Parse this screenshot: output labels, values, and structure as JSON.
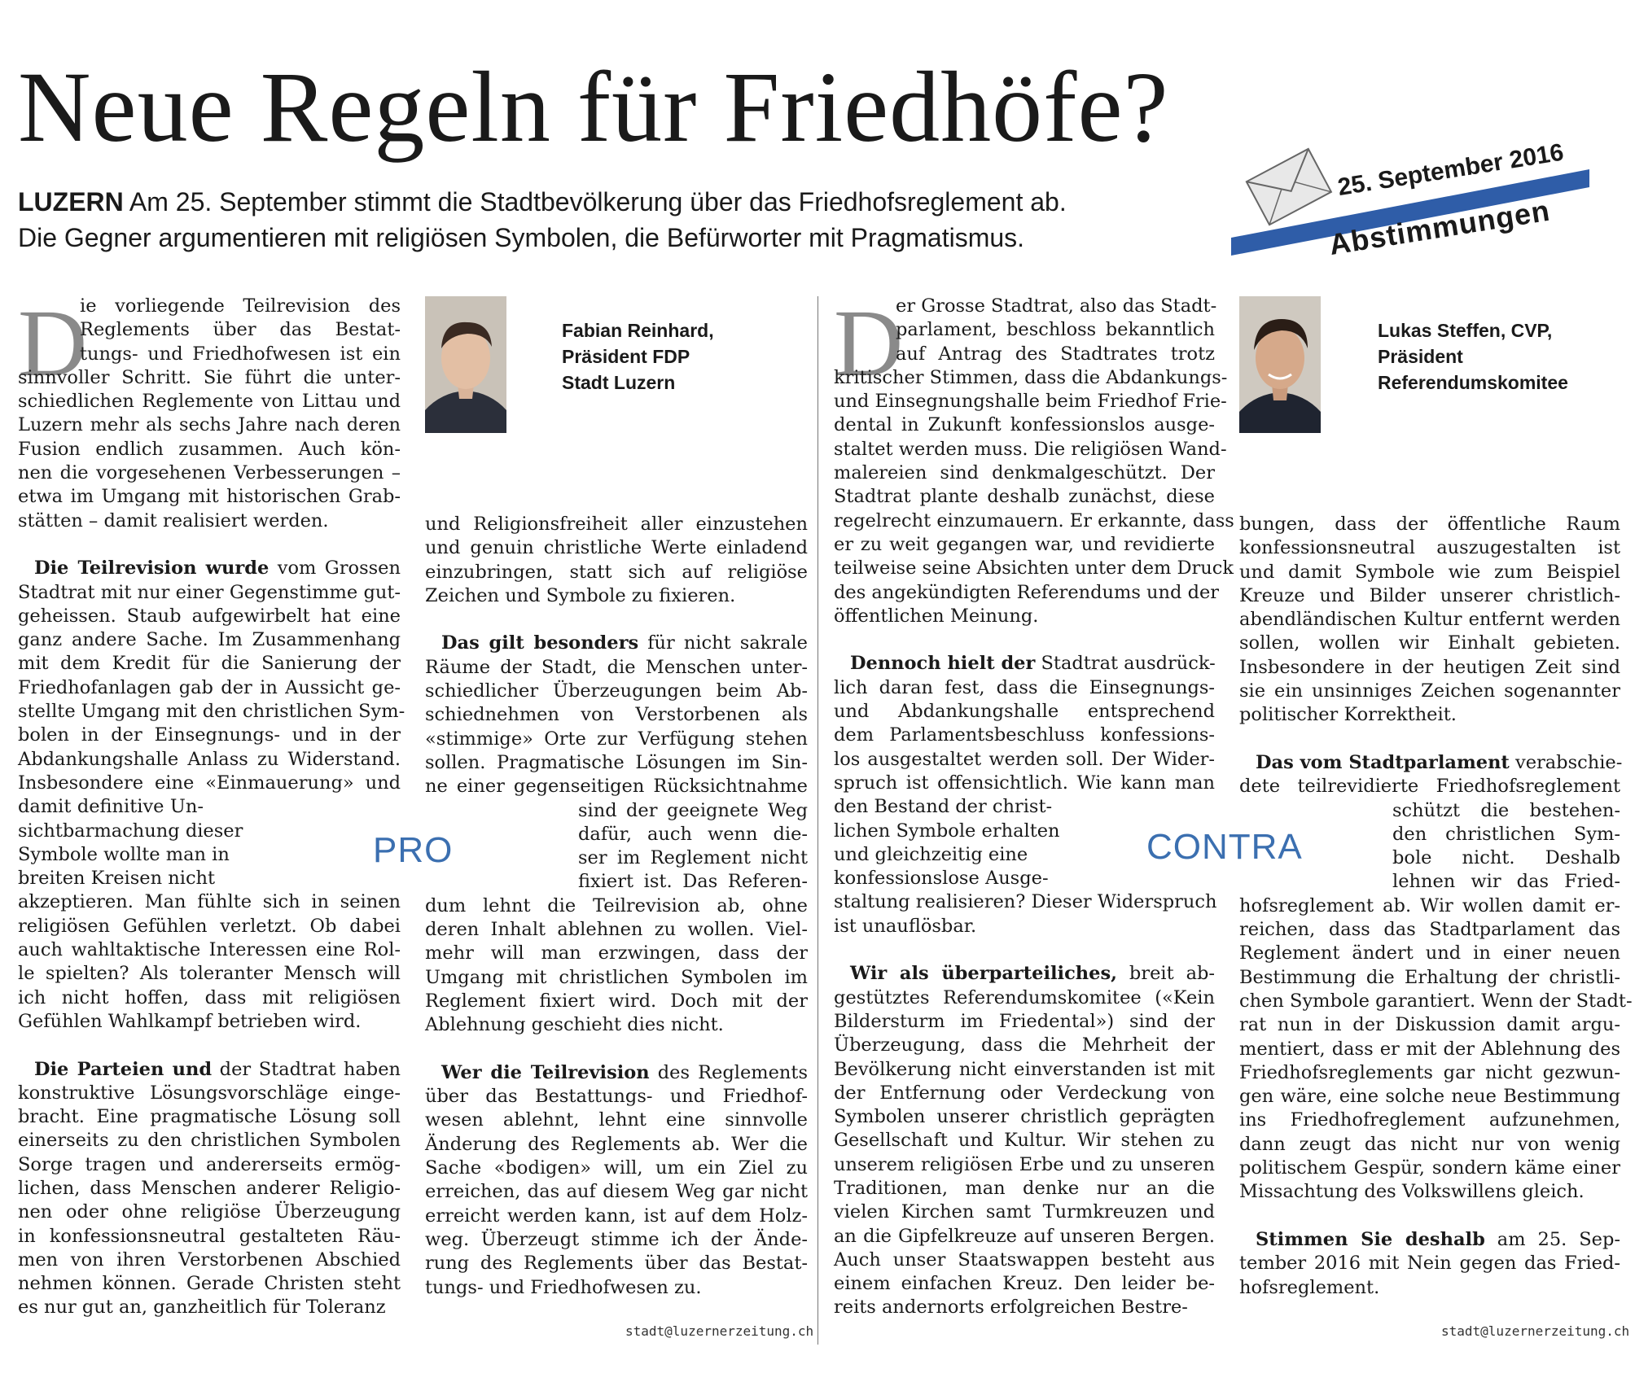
{
  "header": {
    "title": "Neue Regeln für Friedhöfe?",
    "dateline": "LUZERN",
    "lead_line1": "Am 25. September stimmt die Stadtbevölkerung über das Friedhofsreglement ab.",
    "lead_line2": "Die Gegner argumentieren mit religiösen Symbolen, die Befürworter mit Pragmatismus."
  },
  "badge": {
    "date": "25. September 2016",
    "label": "Abstimmungen",
    "accent_color": "#2f5da8",
    "icon": "envelope-icon"
  },
  "pro": {
    "side_label": "PRO",
    "author_name": "Fabian Reinhard,",
    "author_role1": "Präsident FDP",
    "author_role2": "Stadt Luzern",
    "photo_icon": "portrait-photo",
    "email": "stadt@luzernerzeitung.ch",
    "dropcap": "D",
    "col1": [
      "ie vorliegende Teilrevision des",
      "Reglements über das Bestat-",
      "tungs- und Friedhofwesen ist ein",
      "sinnvoller Schritt. Sie führt die unter-",
      "schiedlichen Reglemente von Littau und",
      "Luzern mehr als sechs Jahre nach deren",
      "Fusion endlich zusammen. Auch kön-",
      "nen die vorgesehenen Verbesserungen –",
      "etwa im Umgang mit historischen Grab-",
      "stätten – damit realisiert werden.",
      "Die Teilrevision wurde|vom Grossen",
      "Stadtrat mit nur einer Gegenstimme gut-",
      "geheissen. Staub aufgewirbelt hat eine",
      "ganz andere Sache. Im Zusammenhang",
      "mit dem Kredit für die Sanierung der",
      "Friedhofanlagen gab der in Aussicht ge-",
      "stellte Umgang mit den christlichen Sym-",
      "bolen in der Einsegnungs- und in der",
      "Abdankungshalle Anlass zu Widerstand.",
      "Insbesondere eine «Einmauerung» und",
      "damit definitive Un-",
      "sichtbarmachung dieser",
      "Symbole wollte man in",
      "breiten Kreisen nicht",
      "akzeptieren. Man fühlte sich in seinen",
      "religiösen Gefühlen verletzt. Ob dabei",
      "auch wahltaktische Interessen eine Rol-",
      "le spielten? Als toleranter Mensch will",
      "ich nicht hoffen, dass mit religiösen",
      "Gefühlen Wahlkampf betrieben wird.",
      "Die Parteien und|der Stadtrat haben",
      "konstruktive Lösungsvorschläge einge-",
      "bracht. Eine pragmatische Lösung soll",
      "einerseits zu den christlichen Symbolen",
      "Sorge tragen und andererseits ermög-",
      "lichen, dass Menschen anderer Religio-",
      "nen oder ohne religiöse Überzeugung",
      "in konfessionsneutral gestalteten Räu-",
      "men von ihren Verstorbenen Abschied",
      "nehmen können. Gerade Christen steht",
      "es nur gut an, ganzheitlich für Toleranz"
    ],
    "col2": [
      "und Religionsfreiheit aller einzustehen",
      "und genuin christliche Werte einladend",
      "einzubringen, statt sich auf religiöse",
      "Zeichen und Symbole zu fixieren.",
      "Das gilt besonders|für nicht sakrale",
      "Räume der Stadt, die Menschen unter-",
      "schiedlicher Überzeugungen beim Ab-",
      "schiednehmen von Verstorbenen als",
      "«stimmige» Orte zur Verfügung stehen",
      "sollen. Pragmatische Lösungen im Sin-",
      "ne einer gegenseitigen Rücksichtnahme",
      "sind der geeignete Weg",
      "dafür, auch wenn die-",
      "ser im Reglement nicht",
      "fixiert ist. Das Referen-",
      "dum lehnt die Teilrevision ab, ohne",
      "deren Inhalt ablehnen zu wollen. Viel-",
      "mehr will man erzwingen, dass der",
      "Umgang mit christlichen Symbolen im",
      "Reglement fixiert wird. Doch mit der",
      "Ablehnung geschieht dies nicht.",
      "Wer die Teilrevision|des Reglements",
      "über das Bestattungs- und Friedhof-",
      "wesen ablehnt, lehnt eine sinnvolle",
      "Änderung des Reglements ab. Wer die",
      "Sache «bodigen» will, um ein Ziel zu",
      "erreichen, das auf diesem Weg gar nicht",
      "erreicht werden kann, ist auf dem Holz-",
      "weg. Überzeugt stimme ich der Ände-",
      "rung des Reglements über das Bestat-",
      "tungs- und Friedhofwesen zu."
    ]
  },
  "contra": {
    "side_label": "CONTRA",
    "author_name": "Lukas Steffen, CVP,",
    "author_role1": "Präsident",
    "author_role2": "Referendumskomitee",
    "photo_icon": "portrait-photo",
    "email": "stadt@luzernerzeitung.ch",
    "dropcap": "D",
    "col3": [
      "er Grosse Stadtrat, also das Stadt-",
      "parlament, beschloss bekanntlich",
      "auf Antrag des Stadtrates trotz",
      "kritischer Stimmen, dass die Abdankungs-",
      "und Einsegnungshalle beim Friedhof Frie-",
      "dental in Zukunft konfessionslos ausge-",
      "staltet werden muss. Die religiösen Wand-",
      "malereien sind denkmalgeschützt. Der",
      "Stadtrat plante deshalb zunächst, diese",
      "regelrecht einzumauern. Er erkannte, dass",
      "er zu weit gegangen war, und revidierte",
      "teilweise seine Absichten unter dem Druck",
      "des angekündigten Referendums und der",
      "öffentlichen Meinung.",
      "Dennoch hielt der|Stadtrat ausdrück-",
      "lich daran fest, dass die Einsegnungs-",
      "und Abdankungshalle entsprechend",
      "dem Parlamentsbeschluss konfessions-",
      "los ausgestaltet werden soll. Der Wider-",
      "spruch ist offensichtlich. Wie kann man",
      "den Bestand der christ-",
      "lichen Symbole erhalten",
      "und gleichzeitig eine",
      "konfessionslose Ausge-",
      "staltung realisieren? Dieser Widerspruch",
      "ist unauflösbar.",
      "Wir als überparteiliches,|breit ab-",
      "gestütztes Referendumskomitee («Kein",
      "Bildersturm im Friedental») sind der",
      "Überzeugung, dass die Mehrheit der",
      "Bevölkerung nicht einverstanden ist mit",
      "der Entfernung oder Verdeckung von",
      "Symbolen unserer christlich geprägten",
      "Gesellschaft und Kultur. Wir stehen zu",
      "unserem religiösen Erbe und zu unseren",
      "Traditionen, man denke nur an die",
      "vielen Kirchen samt Turmkreuzen und",
      "an die Gipfelkreuze auf unseren Bergen.",
      "Auch unser Staatswappen besteht aus",
      "einem einfachen Kreuz. Den leider be-",
      "reits andernorts erfolgreichen Bestre-"
    ],
    "col4": [
      "bungen, dass der öffentliche Raum",
      "konfessionsneutral auszugestalten ist",
      "und damit Symbole wie zum Beispiel",
      "Kreuze und Bilder unserer christlich-",
      "abendländischen Kultur entfernt werden",
      "sollen, wollen wir Einhalt gebieten.",
      "Insbesondere in der heutigen Zeit sind",
      "sie ein unsinniges Zeichen sogenannter",
      "politischer Korrektheit.",
      "Das vom Stadtparlament|verabschie-",
      "dete teilrevidierte Friedhofsreglement",
      "schützt die bestehen-",
      "den christlichen Sym-",
      "bole nicht. Deshalb",
      "lehnen wir das Fried-",
      "hofsreglement ab. Wir wollen damit er-",
      "reichen, dass das Stadtparlament das",
      "Reglement ändert und in einer neuen",
      "Bestimmung die Erhaltung der christli-",
      "chen Symbole garantiert. Wenn der Stadt-",
      "rat nun in der Diskussion damit argu-",
      "mentiert, dass er mit der Ablehnung des",
      "Friedhofsreglements gar nicht gezwun-",
      "gen wäre, eine solche neue Bestimmung",
      "ins Friedhofreglement aufzunehmen,",
      "dann zeugt das nicht nur von wenig",
      "politischem Gespür, sondern käme einer",
      "Missachtung des Volkswillens gleich.",
      "Stimmen Sie deshalb|am 25. Sep-",
      "tember 2016 mit Nein gegen das Fried-",
      "hofsreglement."
    ]
  }
}
